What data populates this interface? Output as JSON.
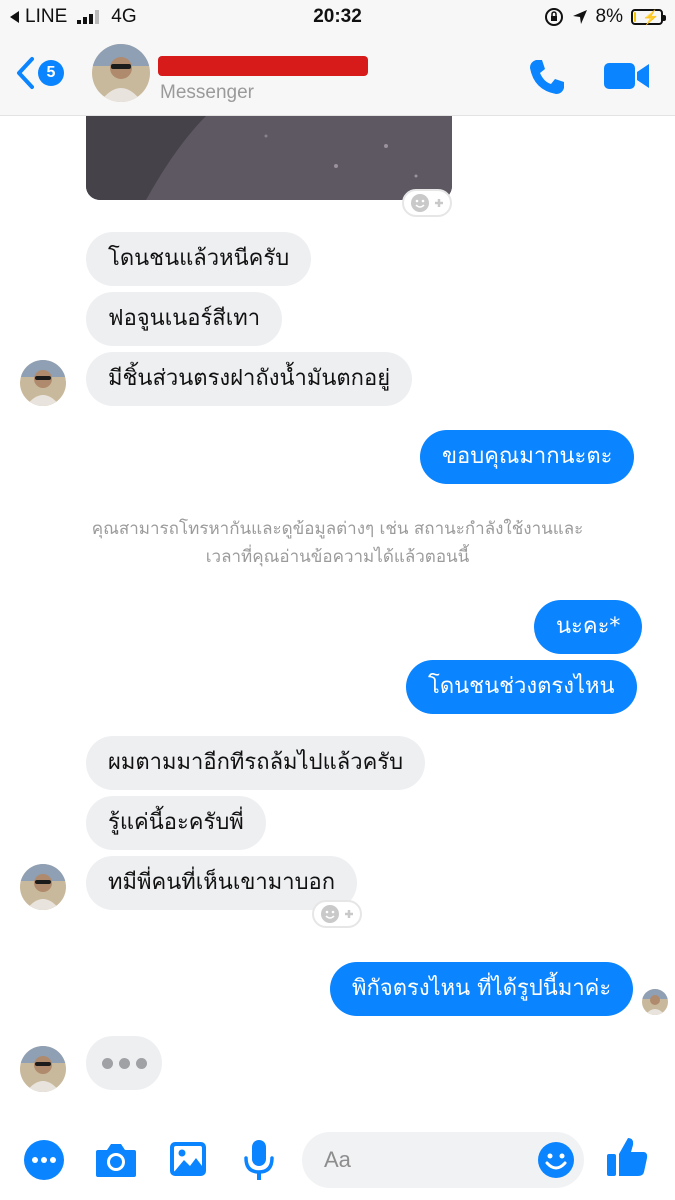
{
  "status_bar": {
    "carrier": "LINE",
    "network": "4G",
    "time": "20:32",
    "battery": "8%",
    "battery_level": 0.08
  },
  "header": {
    "unread_count": "5",
    "subtitle": "Messenger",
    "accent": "#0a84ff"
  },
  "messages": {
    "in_1": "โดนชนแล้วหนีครับ",
    "in_2": "ฟอจูนเนอร์สีเทา",
    "in_3": "มีชิ้นส่วนตรงฝาถังน้ำมันตกอยู่",
    "out_1": "ขอบคุณมากนะตะ",
    "system_note_line1": "คุณสามารถโทรหากันและดูข้อมูลต่างๆ เช่น สถานะกำลังใช้งานและ",
    "system_note_line2": "เวลาที่คุณอ่านข้อความได้แล้วตอนนี้",
    "out_2": "นะคะ*",
    "out_3": "โดนชนช่วงตรงไหน",
    "in_4": "ผมตามมาอีกทีรถล้มไปแล้วครับ",
    "in_5": "รู้แค่นี้อะครับพี่",
    "in_6": "ทมีพี่คนที่เห็นเขามาบอก",
    "out_4": "พิกัจตรงไหน ที่ได้รูปนี้มาค่ะ"
  },
  "composer": {
    "placeholder": "Aa"
  },
  "icons": {
    "back": "chevron-left-icon",
    "call": "phone-icon",
    "video": "video-camera-icon",
    "more": "more-dots-icon",
    "camera": "camera-icon",
    "photo": "image-icon",
    "mic": "microphone-icon",
    "emoji": "smiley-icon",
    "like": "thumbs-up-icon"
  }
}
